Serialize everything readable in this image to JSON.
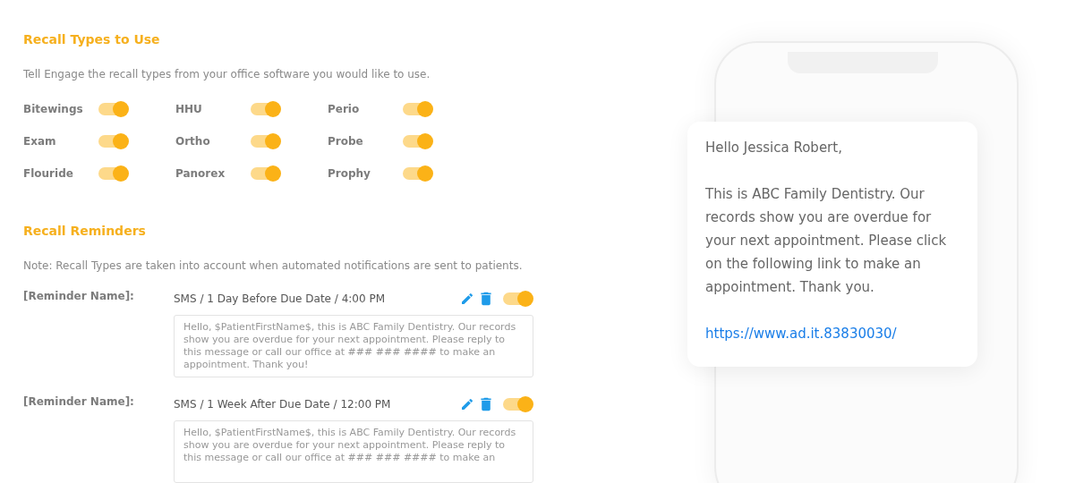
{
  "recall_types": {
    "title": "Recall Types to Use",
    "description": "Tell Engage the recall types from your office software you would like to use.",
    "items": [
      {
        "label": "Bitewings",
        "on": true
      },
      {
        "label": "HHU",
        "on": true
      },
      {
        "label": "Perio",
        "on": true
      },
      {
        "label": "Exam",
        "on": true
      },
      {
        "label": "Ortho",
        "on": true
      },
      {
        "label": "Probe",
        "on": true
      },
      {
        "label": "Flouride",
        "on": true
      },
      {
        "label": "Panorex",
        "on": true
      },
      {
        "label": "Prophy",
        "on": true
      }
    ]
  },
  "recall_reminders": {
    "title": "Recall Reminders",
    "note": "Note: Recall Types are taken into account when automated notifications are sent to patients.",
    "reminders": [
      {
        "name": "[Reminder Name]:",
        "schedule": "SMS / 1 Day Before Due Date / 4:00 PM",
        "on": true,
        "message": "Hello, $PatientFirstName$, this is ABC Family Dentistry. Our records show you are overdue for your next appointment. Please reply to this message or call our office at ### ### #### to make an appointment. Thank you!"
      },
      {
        "name": "[Reminder Name]:",
        "schedule": "SMS / 1 Week After Due Date / 12:00 PM",
        "on": true,
        "message": "Hello, $PatientFirstName$, this is ABC Family Dentistry. Our records show you are overdue for your next appointment. Please reply to this message or call our office at ### ### #### to make an"
      }
    ]
  },
  "phone_preview": {
    "greeting": "Hello Jessica Robert,",
    "body": "This is ABC Family Dentistry. Our records show you are overdue for your next appointment. Please click on the following link to make an appointment. Thank you.",
    "link": "https://www.ad.it.83830030/"
  }
}
